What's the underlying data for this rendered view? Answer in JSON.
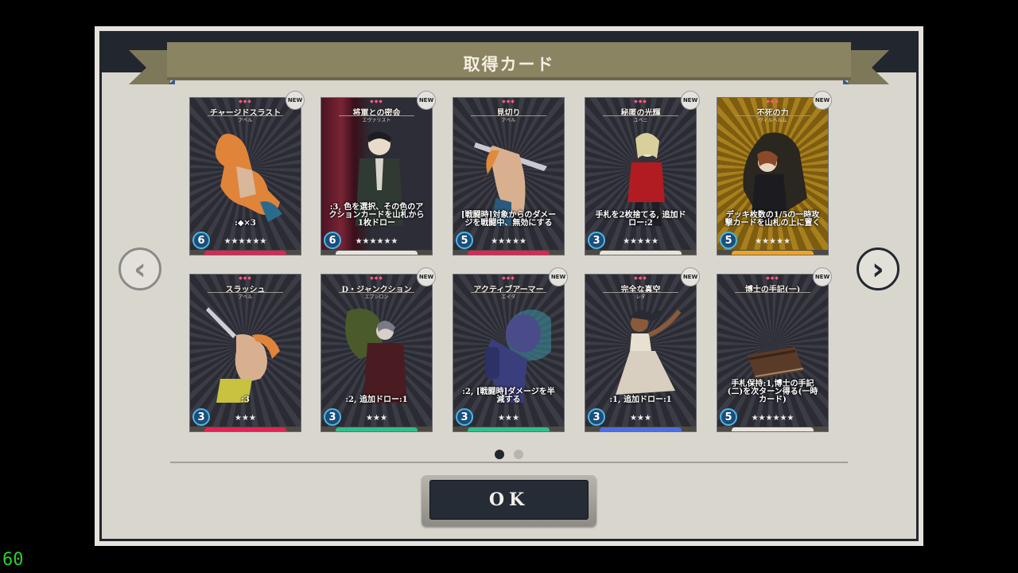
{
  "dialog": {
    "title": "取得カード",
    "ok_label": "OK"
  },
  "badge_label": "NEW",
  "pagination": {
    "pages": 2,
    "current": 1
  },
  "fps": "60",
  "colors": {
    "panel": "#d9d6ce",
    "frame": "#22262e",
    "ribbon": "#8a8463",
    "ok_button": "#262c36"
  },
  "cards": [
    {
      "title": "チャージドスラスト",
      "subtitle": "アベル",
      "desc": ":◆×3",
      "cost": "6",
      "stars": "★★★★★★",
      "bar": "#e02454",
      "art": "art-warrior-orange",
      "new": true
    },
    {
      "title": "将軍との密会",
      "subtitle": "エヴァリスト",
      "desc": ":3, 色を選択、その色のアクションカードを山札から1枚ドロー",
      "cost": "6",
      "stars": "★★★★★★",
      "bar": "#e8e4dc",
      "art": "art-suited-man",
      "new": true
    },
    {
      "title": "見切り",
      "subtitle": "アベル",
      "desc": "[戦闘時]対象からのダメージを戦闘中、無効にする",
      "cost": "5",
      "stars": "★★★★★",
      "bar": "#e02454",
      "art": "art-swordsman",
      "new": false
    },
    {
      "title": "秘匿の光輝",
      "subtitle": "ユベニ",
      "desc": "手札を2枚捨てる, 追加ドロー:2",
      "cost": "3",
      "stars": "★★★★★",
      "bar": "#e8e4dc",
      "art": "art-blonde-red",
      "new": true
    },
    {
      "title": "不死の力",
      "subtitle": "ヴィルヘルム",
      "desc": "デッキ枚数の1/5の一時攻撃カードを山札の上に置く",
      "cost": "5",
      "stars": "★★★★★",
      "bar": "#f0a41e",
      "art": "art-hooded-pair",
      "new": true
    },
    {
      "title": "スラッシュ",
      "subtitle": "アベル",
      "desc": ":3",
      "cost": "3",
      "stars": "★★★",
      "bar": "#e02454",
      "art": "art-slash",
      "new": false
    },
    {
      "title": "D・ジャンクション",
      "subtitle": "エプシロン",
      "desc": ":2, 追加ドロー:1",
      "cost": "3",
      "stars": "★★★",
      "bar": "#2fbf8c",
      "art": "art-cloaked",
      "new": true
    },
    {
      "title": "アクティブアーマー",
      "subtitle": "エイダ",
      "desc": ":2, [戦闘時]ダメージを半減する",
      "cost": "3",
      "stars": "★★★",
      "bar": "#2fbf8c",
      "art": "art-robot",
      "new": true
    },
    {
      "title": "完全な真空",
      "subtitle": "レダ",
      "desc": ":1, 追加ドロー:1",
      "cost": "3",
      "stars": "★★★",
      "bar": "#4d6de0",
      "art": "art-dancer",
      "new": true
    },
    {
      "title": "博士の手記(一)",
      "subtitle": "",
      "desc": "手札保持:1,博士の手記(二)を次ターン得る(一時カード)",
      "cost": "5",
      "stars": "★★★★★★",
      "bar": "#e8e4dc",
      "art": "art-journal",
      "new": true
    }
  ]
}
